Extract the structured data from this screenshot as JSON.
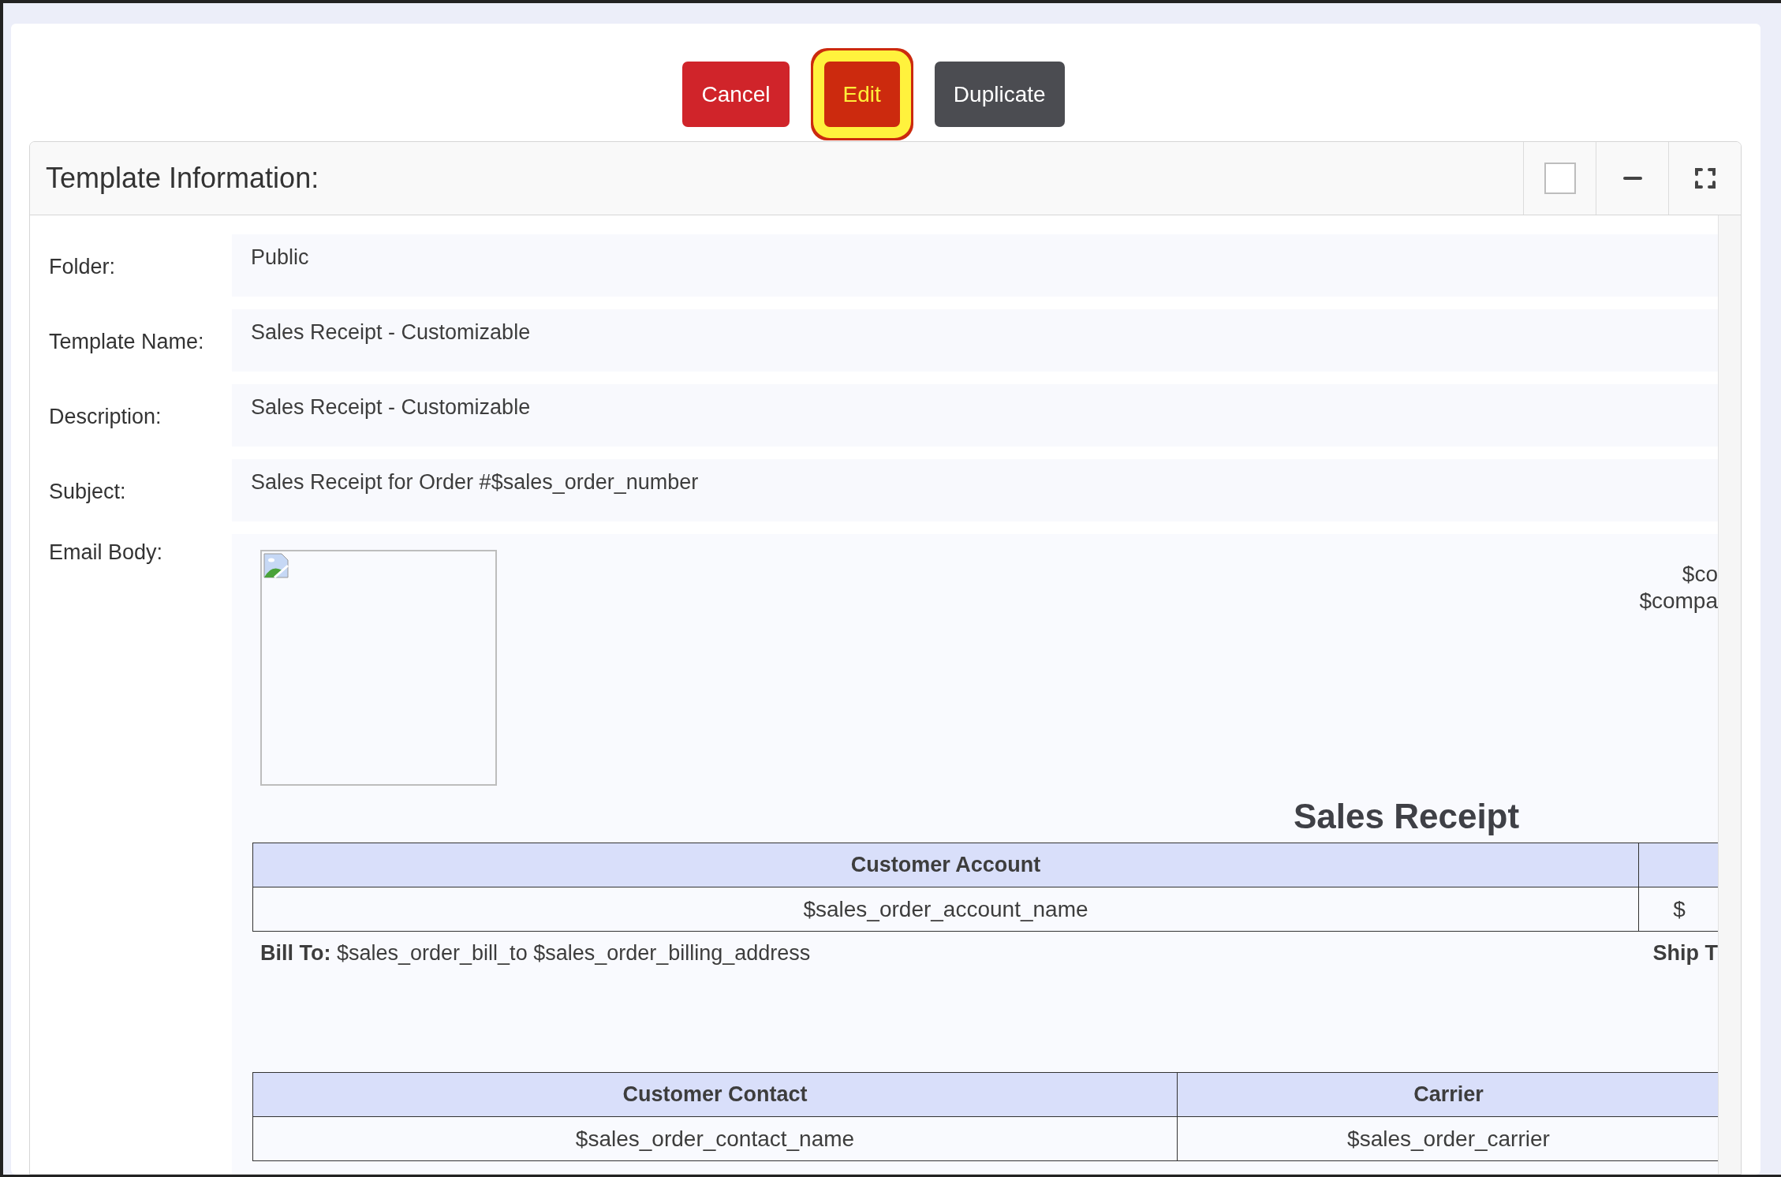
{
  "toolbar": {
    "buttons": [
      {
        "label": "Cancel",
        "kind": "danger",
        "highlighted": false
      },
      {
        "label": "Edit",
        "kind": "danger",
        "highlighted": true
      },
      {
        "label": "Duplicate",
        "kind": "secondary",
        "highlighted": false
      }
    ]
  },
  "panel": {
    "title": "Template Information:",
    "fields": [
      {
        "label": "Folder:",
        "value": "Public"
      },
      {
        "label": "Template Name:",
        "value": "Sales Receipt - Customizable"
      },
      {
        "label": "Description:",
        "value": "Sales Receipt - Customizable"
      },
      {
        "label": "Subject:",
        "value": "Sales Receipt for Order #$sales_order_number"
      }
    ],
    "email_body": {
      "label": "Email Body:",
      "company_lines": [
        "$co",
        "$compa"
      ],
      "heading": "Sales Receipt",
      "tables": [
        {
          "header": [
            "Customer Account"
          ],
          "rows": [
            [
              "$sales_order_account_name",
              "$"
            ]
          ]
        },
        {
          "header": [
            "Customer Contact",
            "Carrier"
          ],
          "rows": [
            [
              "$sales_order_contact_name",
              "$sales_order_carrier"
            ]
          ]
        }
      ],
      "bill_to": "**Bill To:** $sales_order_bill_to $sales_order_billing_address",
      "ship_to": "Ship T"
    }
  }
}
